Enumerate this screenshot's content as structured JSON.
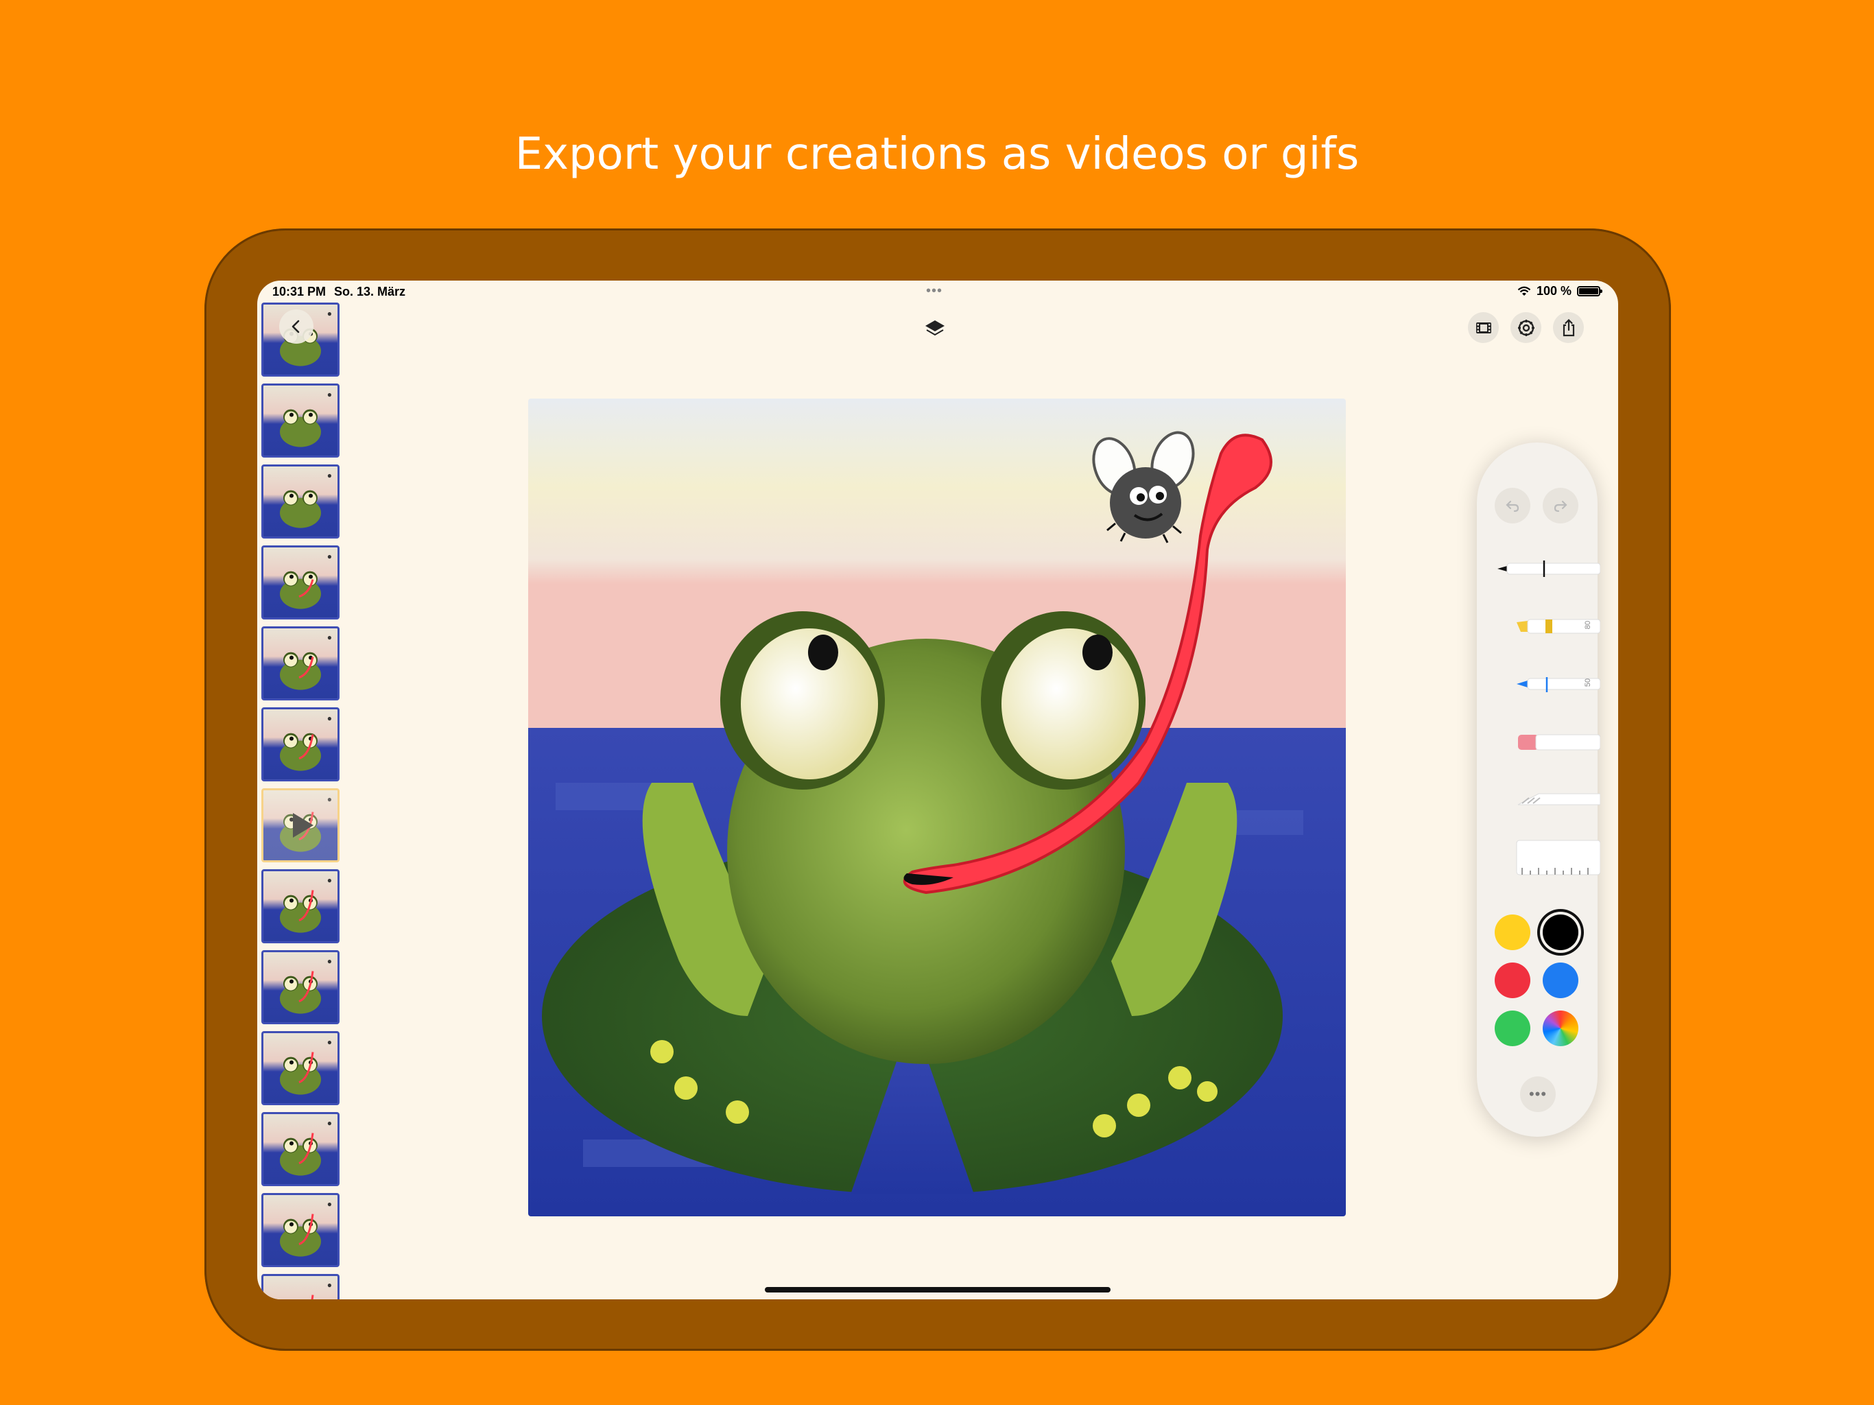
{
  "headline": "Export your creations as videos or gifs",
  "status_bar": {
    "time": "10:31 PM",
    "date": "So. 13. März",
    "battery": "100 %",
    "dots": "•••"
  },
  "toolbar": {
    "back_icon": "chevron-left-icon",
    "layers_icon": "layers-icon",
    "right_buttons": [
      "film-icon",
      "settings-icon",
      "share-icon"
    ]
  },
  "filmstrip": {
    "frame_count": 13,
    "current_frame_index": 6
  },
  "palette": {
    "tools": [
      "pen",
      "marker",
      "pencil",
      "eraser",
      "lasso",
      "ruler"
    ],
    "marker_size": "80",
    "pencil_size": "50",
    "colors": [
      "#FFD020",
      "#000000",
      "#F0303F",
      "#1E7CF2",
      "#34C759",
      "color-wheel"
    ],
    "selected_color": "#000000",
    "more_label": "•••"
  },
  "accent_colors": {
    "background": "#FF8C00",
    "bezel": "#995500",
    "screen": "#FDF6E9"
  }
}
